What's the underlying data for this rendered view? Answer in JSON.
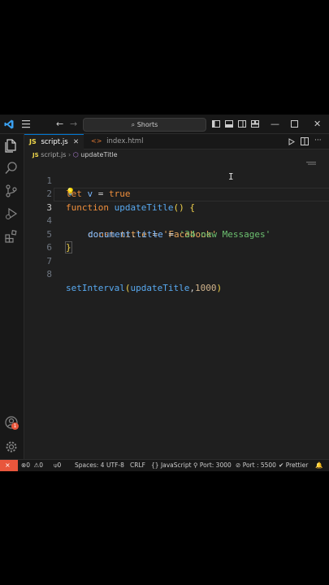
{
  "titlebar": {
    "search_label": "Shorts"
  },
  "tabs": [
    {
      "label": "script.js",
      "icon": "JS"
    },
    {
      "label": "index.html",
      "icon": "<>"
    }
  ],
  "breadcrumb": {
    "file": "script.js",
    "symbol": "updateTitle"
  },
  "editor": {
    "lines": [
      {
        "n": "1"
      },
      {
        "n": "2"
      },
      {
        "n": "3"
      },
      {
        "n": "4"
      },
      {
        "n": "5"
      },
      {
        "n": "6"
      },
      {
        "n": "7"
      },
      {
        "n": "8"
      }
    ],
    "tokens": {
      "l1_kw": "let",
      "l1_var": "v",
      "l1_eq": "=",
      "l1_val": "true",
      "l2_kw": "function",
      "l2_fn": "updateTitle",
      "l2_paren": "()",
      "l2_brace": "{",
      "l3_kw": "const",
      "l3_var": "title",
      "l3_eq": "=",
      "l3_str": "'Facebook'",
      "l4_obj": "document",
      "l4_dot": ".",
      "l4_prop": "title",
      "l4_eq": "=",
      "l4_str": "'34 new Messages'",
      "l5_brace": "}",
      "l8_fn": "setInterval",
      "l8_open": "(",
      "l8_arg": "updateTitle",
      "l8_comma": ",",
      "l8_num": "1000",
      "l8_close": ")"
    }
  },
  "activity": {
    "badge": "1"
  },
  "status": {
    "errors": "0",
    "warnings": "0",
    "info": "0",
    "spaces": "Spaces: 4",
    "encoding": "UTF-8",
    "eol": "CRLF",
    "language": "JavaScript",
    "port1": "Port: 3000",
    "port2": "Port : 5500",
    "prettier": "Prettier"
  },
  "colors": {
    "accent": "#0078d4",
    "remote": "#e8563c",
    "badge": "#e8563c"
  }
}
